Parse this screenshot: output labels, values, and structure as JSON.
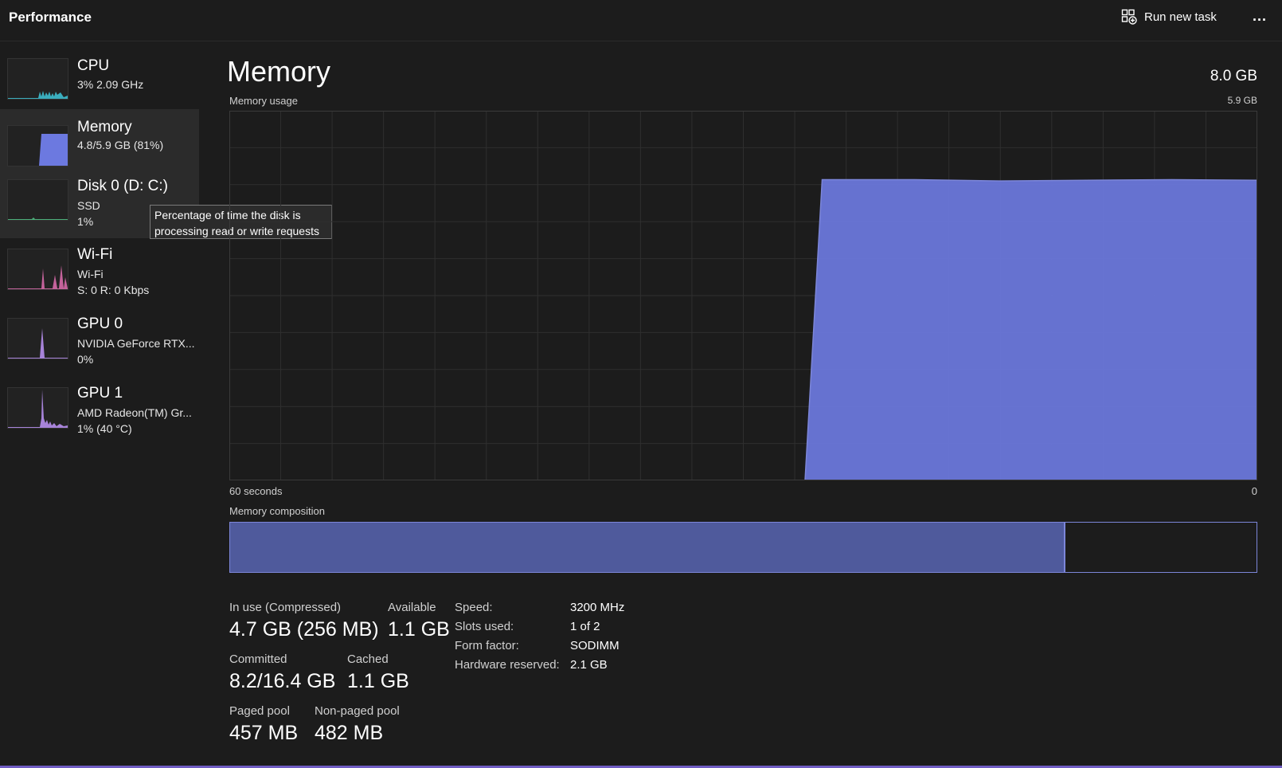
{
  "header": {
    "title": "Performance",
    "run_new_task_label": "Run new task",
    "more_label": "..."
  },
  "sidebar": {
    "items": [
      {
        "name": "CPU",
        "lines": [
          "3%  2.09 GHz"
        ],
        "color": "#3ec6d8"
      },
      {
        "name": "Memory",
        "lines": [
          "4.8/5.9 GB (81%)"
        ],
        "color": "#6c79e0",
        "selected": true
      },
      {
        "name": "Disk 0 (D: C:)",
        "lines": [
          "SSD",
          "1%"
        ],
        "color": "#4caf7a"
      },
      {
        "name": "Wi-Fi",
        "lines": [
          "Wi-Fi",
          "S: 0  R: 0 Kbps"
        ],
        "color": "#e06fb0"
      },
      {
        "name": "GPU 0",
        "lines": [
          "NVIDIA GeForce RTX...",
          "0%"
        ],
        "color": "#a783d9"
      },
      {
        "name": "GPU 1",
        "lines": [
          "AMD Radeon(TM) Gr...",
          "1%  (40 °C)"
        ],
        "color": "#a783d9"
      }
    ]
  },
  "tooltip": {
    "text": "Percentage of time the disk is processing read or write requests"
  },
  "main": {
    "title": "Memory",
    "total": "8.0 GB",
    "usage_label": "Memory usage",
    "usage_max": "5.9 GB",
    "axis_left": "60 seconds",
    "axis_right": "0",
    "composition_label": "Memory composition",
    "composition_in_use_fraction": 0.814,
    "accent_color": "#6c79e0"
  },
  "chart_data": {
    "type": "area",
    "title": "Memory usage",
    "x": [
      60,
      56,
      4,
      3.4,
      3.3,
      3,
      2.4,
      0
    ],
    "y": [
      0,
      0,
      0,
      0,
      0,
      0,
      0,
      0
    ],
    "points": [
      {
        "seconds_ago": 60,
        "gb": 0
      },
      {
        "seconds_ago": 26.4,
        "gb": 0
      },
      {
        "seconds_ago": 25.4,
        "gb": 4.8
      },
      {
        "seconds_ago": 20,
        "gb": 4.8
      },
      {
        "seconds_ago": 15,
        "gb": 4.78
      },
      {
        "seconds_ago": 10,
        "gb": 4.79
      },
      {
        "seconds_ago": 5,
        "gb": 4.8
      },
      {
        "seconds_ago": 0,
        "gb": 4.79
      }
    ],
    "xlim": [
      60,
      0
    ],
    "ylim": [
      0,
      5.9
    ],
    "grid": true
  },
  "stats": {
    "in_use_label": "In use (Compressed)",
    "in_use_value": "4.7 GB (256 MB)",
    "available_label": "Available",
    "available_value": "1.1 GB",
    "committed_label": "Committed",
    "committed_value": "8.2/16.4 GB",
    "cached_label": "Cached",
    "cached_value": "1.1 GB",
    "paged_pool_label": "Paged pool",
    "paged_pool_value": "457 MB",
    "non_paged_pool_label": "Non-paged pool",
    "non_paged_pool_value": "482 MB"
  },
  "info": [
    {
      "key": "Speed:",
      "value": "3200 MHz"
    },
    {
      "key": "Slots used:",
      "value": "1 of 2"
    },
    {
      "key": "Form factor:",
      "value": "SODIMM"
    },
    {
      "key": "Hardware reserved:",
      "value": "2.1 GB"
    }
  ]
}
